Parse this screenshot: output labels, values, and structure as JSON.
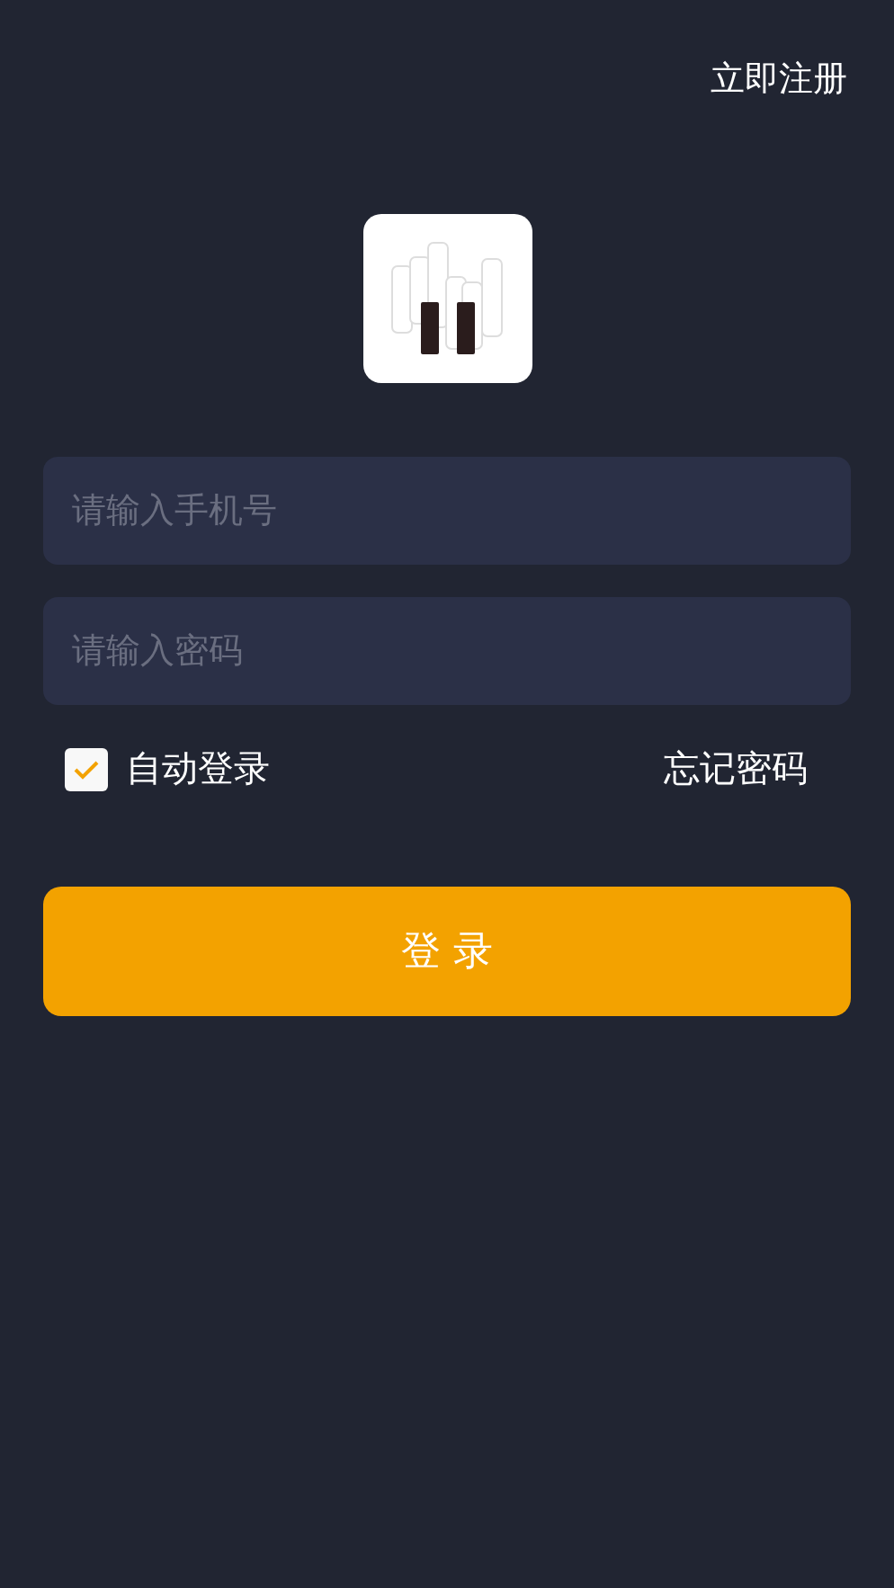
{
  "register_link": "立即注册",
  "phone_field": {
    "placeholder": "请输入手机号"
  },
  "password_field": {
    "placeholder": "请输入密码"
  },
  "auto_login": {
    "label": "自动登录",
    "checked": true
  },
  "forgot_password": "忘记密码",
  "login_button": "登 录"
}
